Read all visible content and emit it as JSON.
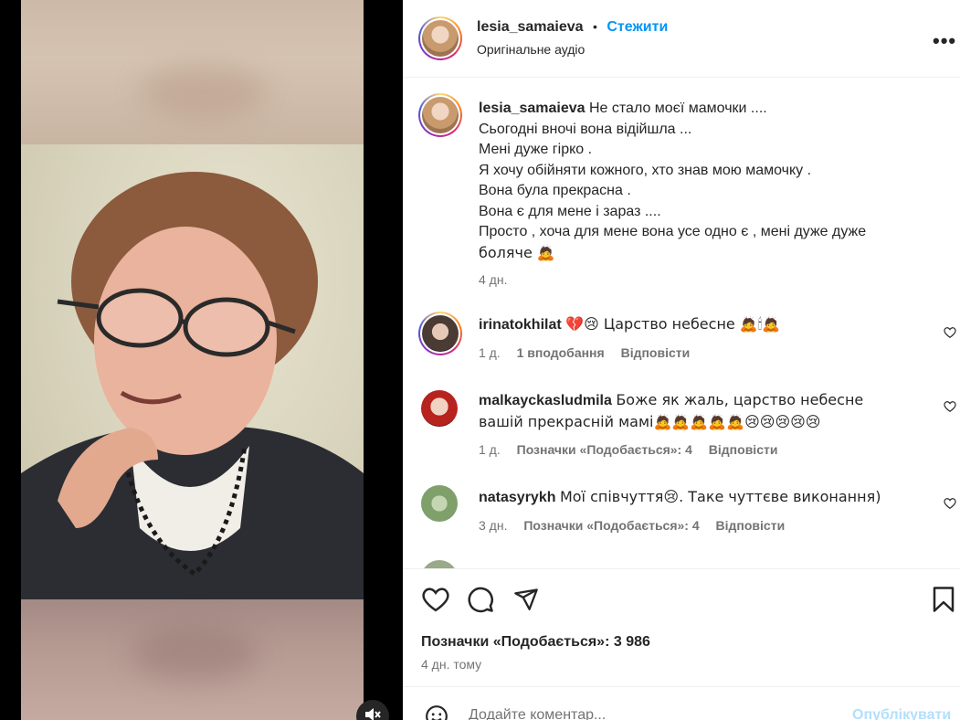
{
  "post": {
    "username": "lesia_samaieva",
    "separator": "•",
    "follow_label": "Стежити",
    "audio_label": "Оригінальне аудіо",
    "more_label": "•••"
  },
  "caption": {
    "username": "lesia_samaieva",
    "lines": [
      "Не стало моєї мамочки ....",
      "Сьогодні вночі вона відійшла ...",
      "Мені дуже гірко .",
      "Я хочу обійняти кожного, хто знав мою мамочку .",
      "Вона була прекрасна .",
      "Вона є для мене і зараз ....",
      "Просто , хоча для мене вона усе одно є , мені дуже дуже",
      "боляче 🙇"
    ],
    "time": "4 дн."
  },
  "comments": [
    {
      "username": "irinatokhilat",
      "text": "💔😢 Царство небесне 🙇🕯🙇",
      "time": "1 д.",
      "likes": "1 вподобання",
      "reply": "Відповісти"
    },
    {
      "username": "malkayckasludmila",
      "text": "Боже як жаль, царство небесне вашій прекрасній мамі🙇🙇🙇🙇🙇😢😢😢😢😢",
      "time": "1 д.",
      "likes": "Позначки «Подобається»: 4",
      "reply": "Відповісти"
    },
    {
      "username": "natasyrykh",
      "text": "Мої співчуття😢. Таке чуттєве виконання)",
      "time": "3 дн.",
      "likes": "Позначки «Подобається»: 4",
      "reply": "Відповісти"
    }
  ],
  "footer": {
    "likes_label": "Позначки «Подобається»: 3 986",
    "time_label": "4 дн. тому",
    "comment_placeholder": "Додайте коментар...",
    "publish_label": "Опублікувати"
  },
  "icons": {
    "heart": "heart-icon",
    "comment": "comment-icon",
    "share": "paper-plane-icon",
    "save": "bookmark-icon",
    "more": "more-horizontal-icon",
    "emoji": "emoji-icon",
    "mute": "speaker-muted-icon"
  },
  "colors": {
    "accent": "#0095f6",
    "text": "#262626",
    "secondary": "#737373",
    "publish_disabled": "#b2dffc"
  }
}
